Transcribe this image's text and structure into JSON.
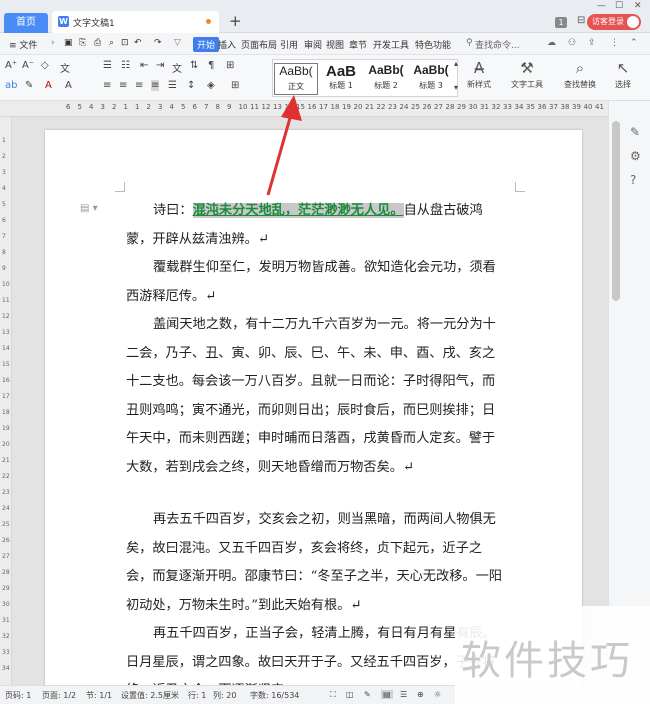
{
  "titlebar": {
    "home_tab": "首页",
    "doc_tab": "文字文稿1",
    "new_tab": "+",
    "notif_count": "1",
    "visitor_login": "访客登录"
  },
  "menubar": {
    "file": "≡ 文件",
    "items": [
      "开始",
      "插入",
      "页面布局",
      "引用",
      "审阅",
      "视图",
      "章节",
      "开发工具",
      "特色功能"
    ],
    "search": "查找命令..."
  },
  "ribbon": {
    "styles": [
      {
        "preview": "AaBb(",
        "label": "正文"
      },
      {
        "preview": "AaB",
        "label": "标题 1"
      },
      {
        "preview": "AaBb(",
        "label": "标题 2"
      },
      {
        "preview": "AaBb(",
        "label": "标题 3"
      }
    ],
    "new_style": "新样式",
    "text_tools": "文字工具",
    "find_replace": "查找替换",
    "select": "选择"
  },
  "ruler": {
    "top_ticks": [
      "6",
      "5",
      "4",
      "3",
      "2",
      "1",
      "1",
      "2",
      "3",
      "4",
      "5",
      "6",
      "7",
      "8",
      "9",
      "10",
      "11",
      "12",
      "13",
      "14",
      "15",
      "16",
      "17",
      "18",
      "19",
      "20",
      "21",
      "22",
      "23",
      "24",
      "25",
      "26",
      "27",
      "28",
      "29",
      "30",
      "31",
      "32",
      "33",
      "34",
      "35",
      "36",
      "37",
      "38",
      "39",
      "40",
      "41"
    ],
    "left_ticks": [
      "1",
      "2",
      "3",
      "4",
      "5",
      "6",
      "7",
      "8",
      "9",
      "10",
      "11",
      "12",
      "13",
      "14",
      "15",
      "16",
      "17",
      "18",
      "19",
      "20",
      "21",
      "22",
      "23",
      "24",
      "25",
      "26",
      "27",
      "28",
      "29",
      "30",
      "31",
      "32",
      "33",
      "34"
    ]
  },
  "document": {
    "p1_lead": "诗曰：",
    "p1_highlight": "混沌未分天地乱，茫茫渺渺无人见。",
    "p1_rest": "自从盘古破鸿蒙，开辟从兹清浊辨。↵",
    "p2": "覆载群生仰至仁，发明万物皆成善。欲知造化会元功，须看西游释厄传。↵",
    "p3": "盖闻天地之数，有十二万九千六百岁为一元。将一元分为十二会，乃子、丑、寅、卯、辰、巳、午、未、申、酉、戌、亥之十二支也。每会该一万八百岁。且就一日而论：子时得阳气，而丑则鸡鸣；寅不通光，而卯则日出；辰时食后，而巳则挨排；日午天中，而未则西蹉；申时晡而日落酉，戌黄昏而人定亥。譬于大数，若到戌会之终，则天地昏缯而万物否矣。↵",
    "p4": "再去五千四百岁，交亥会之初，则当黑暗，而两间人物俱无矣，故曰混沌。又五千四百岁，亥会将终，贞下起元，近子之会，而复逐渐开明。邵康节曰：“冬至子之半，天心无改移。一阳初动处，万物未生时。”到此天始有根。↵",
    "p5": "再五千四百岁，正当子会，轻清上腾，有日有月有星有辰。日月星辰，谓之四象。故曰天开于子。又经五千四百岁，子会将终，近丑之会，而逐渐坚实。"
  },
  "statusbar": {
    "page_code": "页码: 1",
    "page": "页面: 1/2",
    "section": "节: 1/1",
    "setting": "设置值: 2.5厘米",
    "row": "行: 1",
    "col": "列: 20",
    "words": "字数: 16/534"
  },
  "watermark": "软件技巧",
  "colors": {
    "accent": "#3f7ef0",
    "visitor": "#e55353",
    "highlight_text": "#1a8a3c",
    "arrow": "#e03030"
  }
}
